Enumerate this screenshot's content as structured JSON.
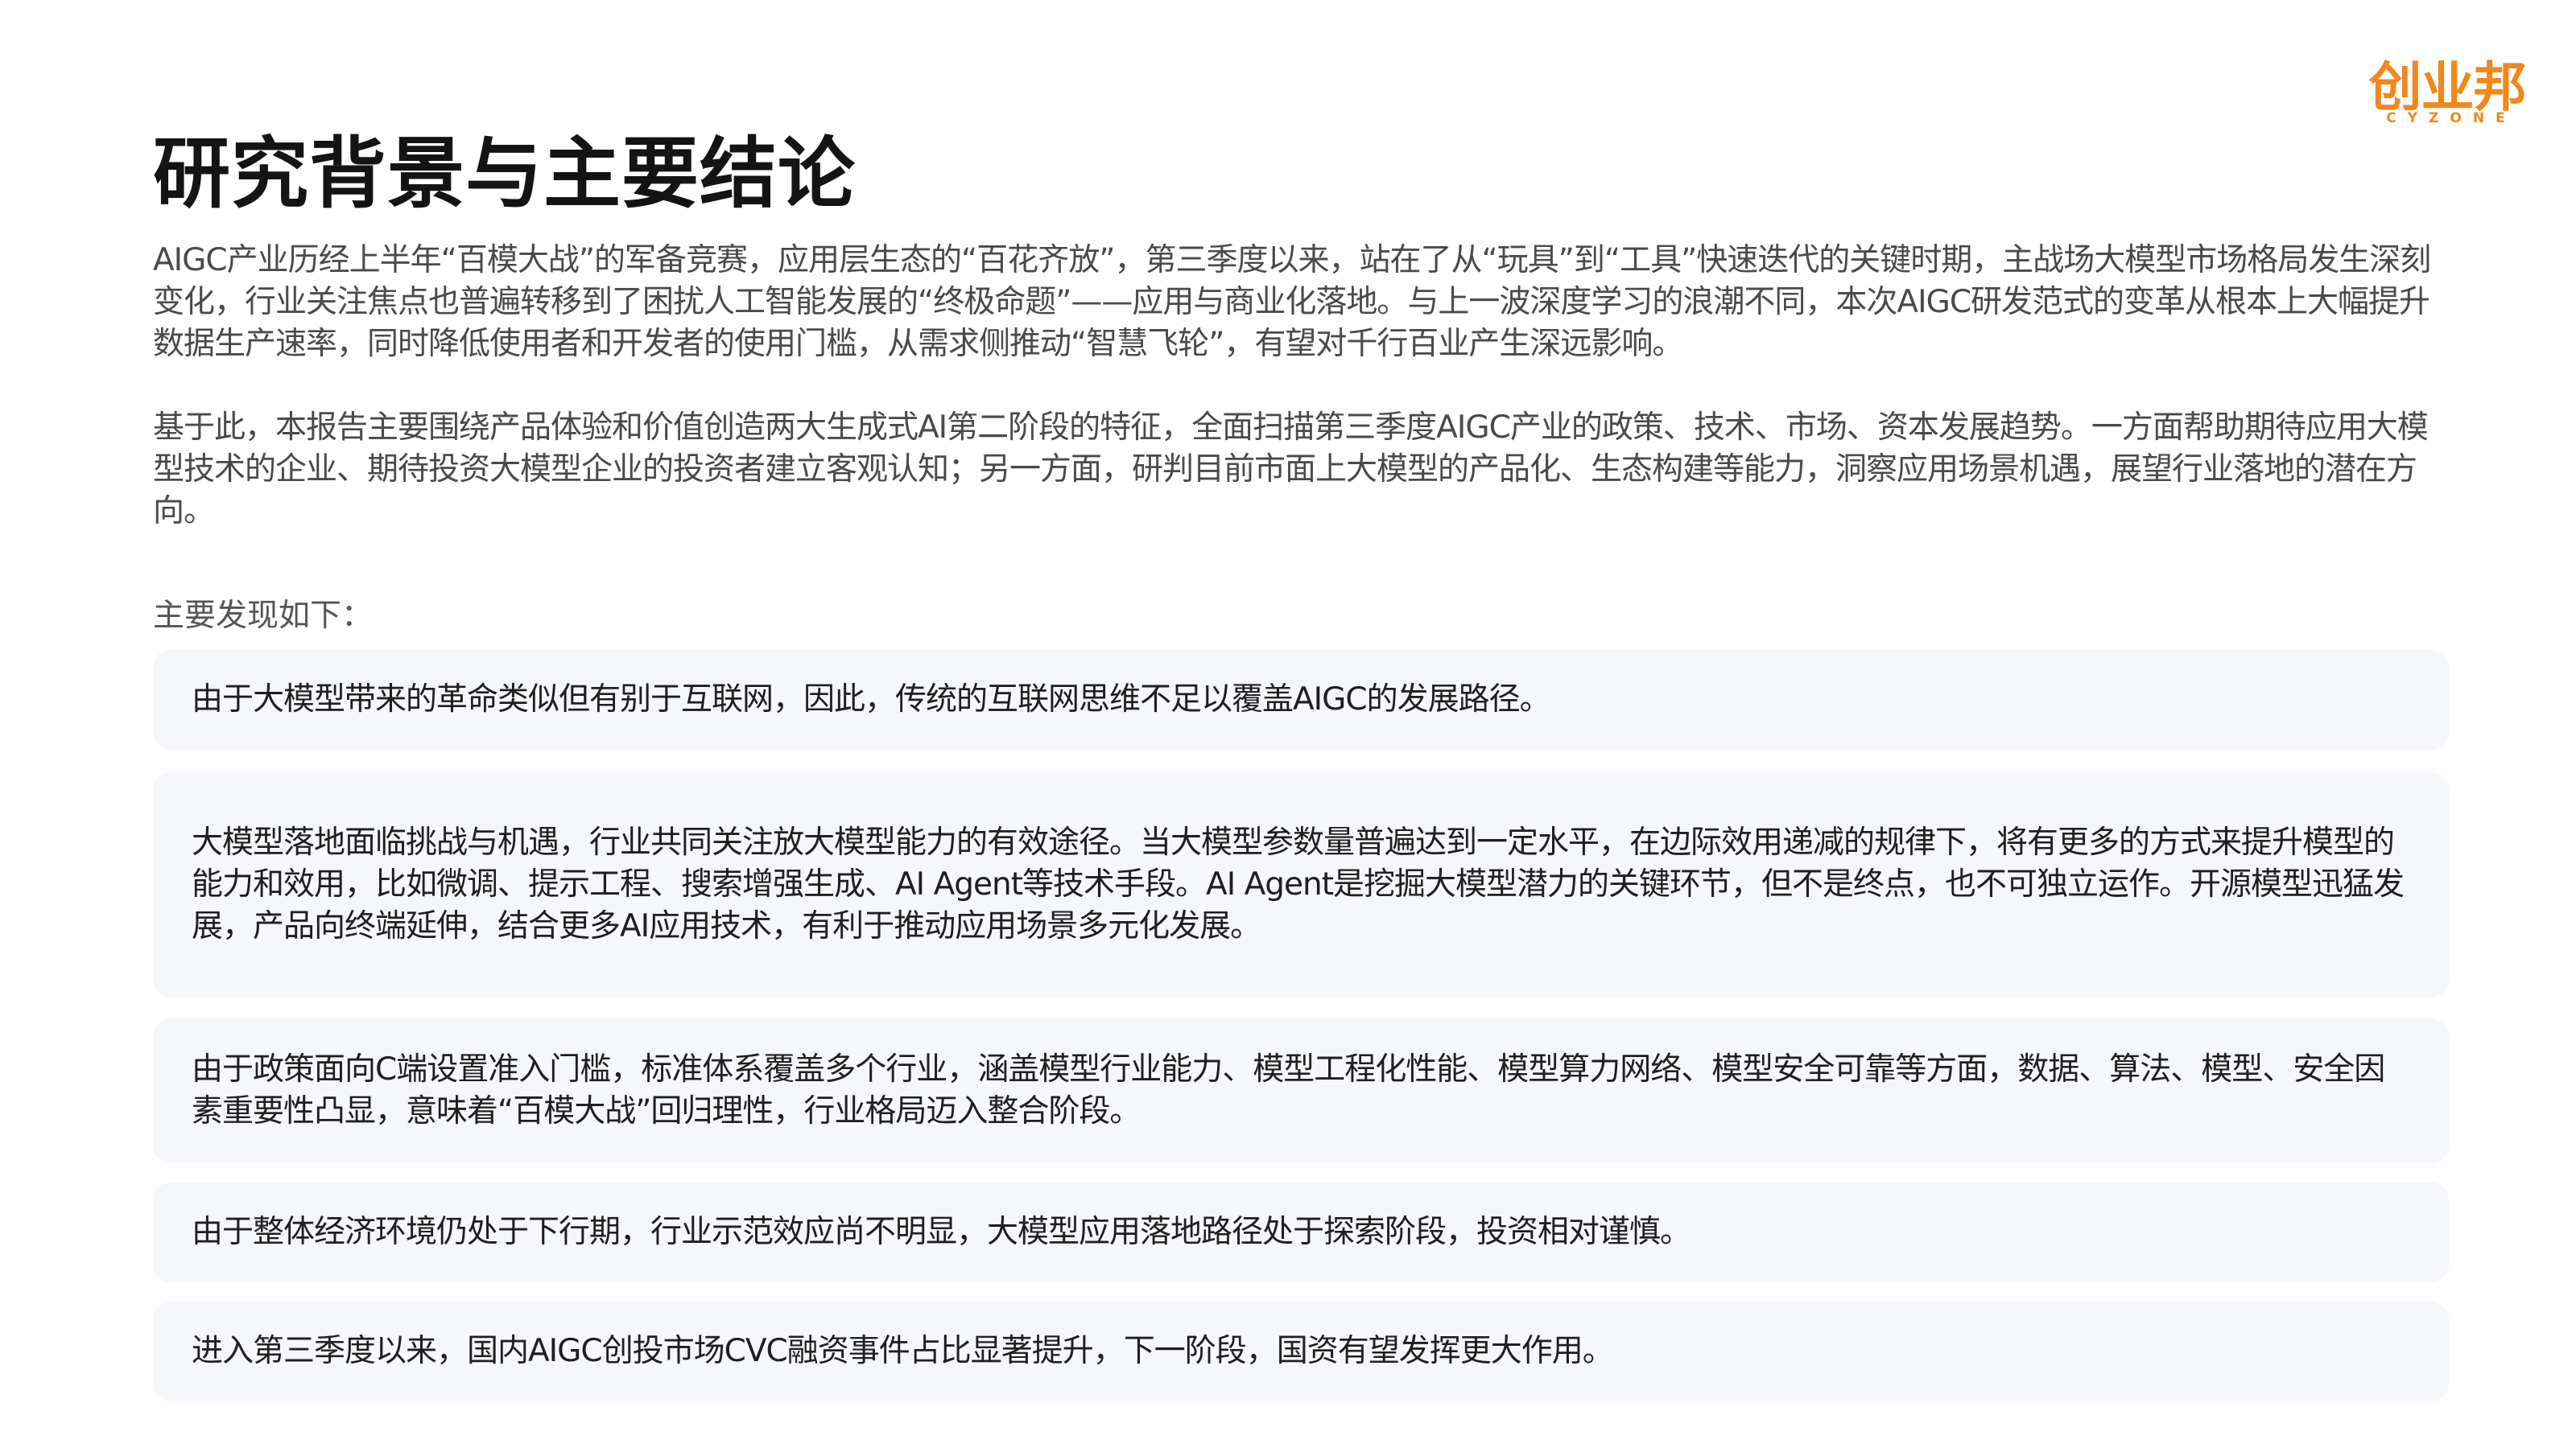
{
  "logo": {
    "cn": "创业邦",
    "en": "CYZONE"
  },
  "title": "研究背景与主要结论",
  "intro": {
    "paragraph_1": "AIGC产业历经上半年“百模大战”的军备竞赛，应用层生态的“百花齐放”，第三季度以来，站在了从“玩具”到“工具”快速迭代的关键时期，主战场大模型市场格局发生深刻变化，行业关注焦点也普遍转移到了困扰人工智能发展的“终极命题”——应用与商业化落地。与上一波深度学习的浪潮不同，本次AIGC研发范式的变革从根本上大幅提升数据生产速率，同时降低使用者和开发者的使用门槛，从需求侧推动“智慧飞轮”，有望对千行百业产生深远影响。",
    "paragraph_2": "基于此，本报告主要围绕产品体验和价值创造两大生成式AI第二阶段的特征，全面扫描第三季度AIGC产业的政策、技术、市场、资本发展趋势。一方面帮助期待应用大模型技术的企业、期待投资大模型企业的投资者建立客观认知；另一方面，研判目前市面上大模型的产品化、生态构建等能力，洞察应用场景机遇，展望行业落地的潜在方向。"
  },
  "findings": {
    "label": "主要发现如下：",
    "items": [
      "由于大模型带来的革命类似但有别于互联网，因此，传统的互联网思维不足以覆盖AIGC的发展路径。",
      "大模型落地面临挑战与机遇，行业共同关注放大模型能力的有效途径。当大模型参数量普遍达到一定水平，在边际效用递减的规律下，将有更多的方式来提升模型的能力和效用，比如微调、提示工程、搜索增强生成、AI Agent等技术手段。AI Agent是挖掘大模型潜力的关键环节，但不是终点，也不可独立运作。开源模型迅猛发展，产品向终端延伸，结合更多AI应用技术，有利于推动应用场景多元化发展。",
      "由于政策面向C端设置准入门槛，标准体系覆盖多个行业，涵盖模型行业能力、模型工程化性能、模型算力网络、模型安全可靠等方面，数据、算法、模型、安全因素重要性凸显，意味着“百模大战”回归理性，行业格局迈入整合阶段。",
      "由于整体经济环境仍处于下行期，行业示范效应尚不明显，大模型应用落地路径处于探索阶段，投资相对谨慎。",
      "进入第三季度以来，国内AIGC创投市场CVC融资事件占比显著提升，下一阶段，国资有望发挥更大作用。"
    ]
  },
  "colors": {
    "brand": "#f2871b",
    "card_bg": "#f6f7fb",
    "title": "#141414",
    "body_text": "#4a4a4a"
  }
}
